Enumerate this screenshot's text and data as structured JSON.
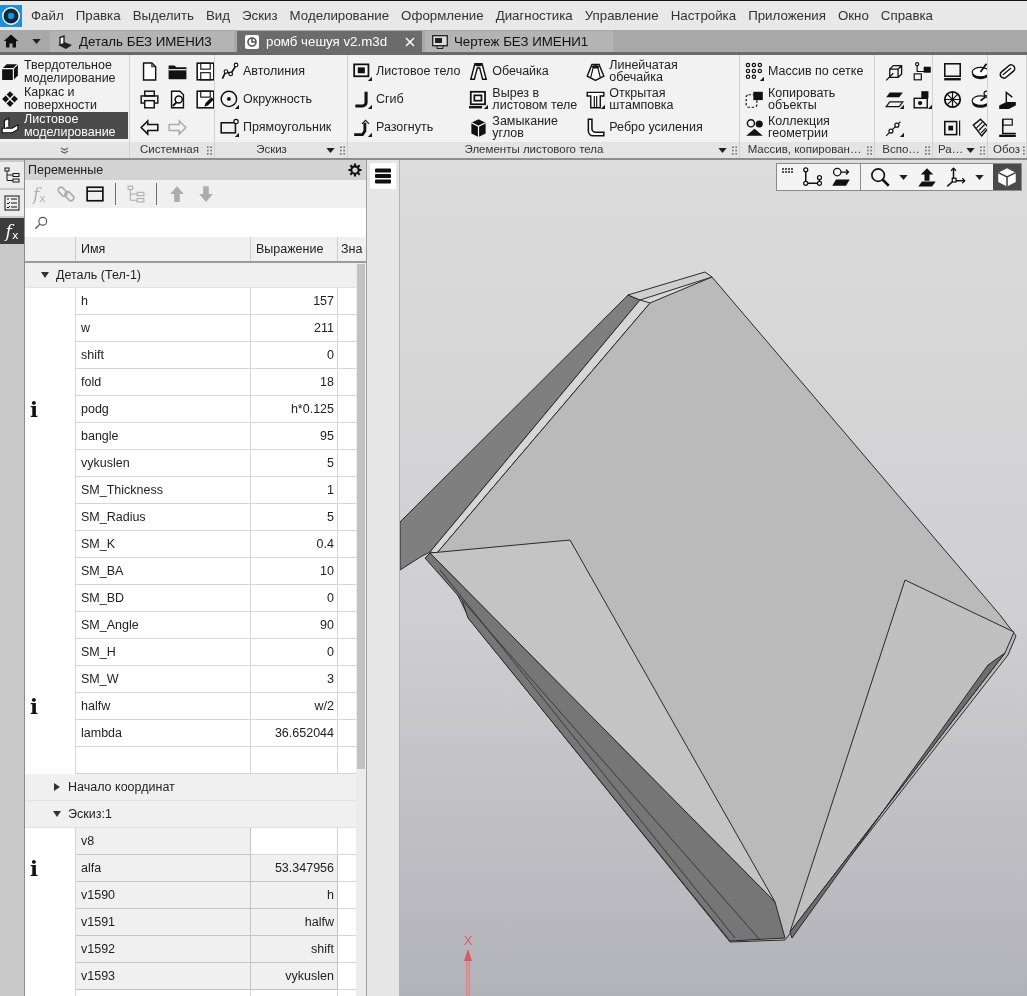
{
  "menu": [
    "Файл",
    "Правка",
    "Выделить",
    "Вид",
    "Эскиз",
    "Моделирование",
    "Оформление",
    "Диагностика",
    "Управление",
    "Настройка",
    "Приложения",
    "Окно",
    "Справка"
  ],
  "tabs": [
    {
      "label": "Деталь БЕЗ ИМЕНИ3",
      "selected": false
    },
    {
      "label": "ромб чешуя v2.m3d",
      "selected": true
    },
    {
      "label": "Чертеж БЕЗ ИМЕНИ1",
      "selected": false
    }
  ],
  "ribbon": {
    "modes": [
      {
        "label": "Твердотельное\nмоделирование",
        "selected": false
      },
      {
        "label": "Каркас и\nповерхности",
        "selected": false
      },
      {
        "label": "Листовое\nмоделирование",
        "selected": true
      }
    ],
    "groups": [
      {
        "kind": "icons",
        "title": "Системная",
        "dropdown": false,
        "buttons": [
          {
            "disabled": false
          },
          {
            "disabled": false
          },
          {
            "disabled": false
          },
          {
            "disabled": false
          },
          {
            "disabled": false
          },
          {
            "disabled": true
          },
          {
            "disabled": false
          },
          {
            "disabled": false
          }
        ]
      },
      {
        "kind": "commands",
        "title": "Эскиз",
        "dropdown": true,
        "columns": [
          [
            "Автолиния",
            "Окружность",
            "Прямоугольник"
          ]
        ]
      },
      {
        "kind": "commands",
        "title": "Элементы листового тела",
        "dropdown": true,
        "columns": [
          [
            "Листовое тело",
            "Сгиб",
            "Разогнуть"
          ],
          [
            "Обечайка",
            "Вырез в\nлистовом теле",
            "Замыкание\nуглов"
          ],
          [
            "Линейчатая\nобечайка",
            "Открытая\nштамповка",
            "Ребро усиления"
          ]
        ]
      },
      {
        "kind": "commands",
        "title": "Массив, копирован…",
        "dropdown": false,
        "columns": [
          [
            "Массив по сетке",
            "Копировать\nобъекты",
            "Коллекция\nгеометрии"
          ]
        ]
      },
      {
        "kind": "icons",
        "title": "Вспо…",
        "dropdown": false,
        "buttons": [
          {
            "disabled": false
          },
          {
            "disabled": false
          },
          {
            "disabled": false
          },
          {
            "disabled": false
          },
          {
            "disabled": false
          }
        ]
      },
      {
        "kind": "icons",
        "title": "Ра…",
        "dropdown": true,
        "buttons": [
          {
            "disabled": false
          },
          {
            "disabled": false
          },
          {
            "disabled": false
          },
          {
            "disabled": false
          },
          {
            "disabled": false
          },
          {
            "disabled": false
          }
        ]
      },
      {
        "kind": "icons",
        "title": "Обоз",
        "dropdown": false,
        "buttons": [
          {
            "disabled": false
          },
          {
            "disabled": false
          },
          {
            "disabled": false
          }
        ]
      }
    ]
  },
  "side_tabs": [
    {
      "selected": false
    },
    {
      "selected": false
    },
    {
      "label": "*f*$_{x}$",
      "selected": true
    }
  ],
  "variables": {
    "title": "Переменные",
    "tools": [
      {
        "label": "*f*$_{x}$",
        "disabled": true
      },
      {
        "disabled": true
      },
      {
        "disabled": false
      },
      {
        "disabled": true
      },
      {
        "disabled": true
      },
      {
        "disabled": true
      }
    ],
    "columns": [
      "Имя",
      "Выражение",
      "Зна"
    ],
    "groups": [
      {
        "kind": "group",
        "name": "Деталь (Тел-1)",
        "expanded": true,
        "children": [
          {
            "kind": "variable",
            "name": "h",
            "expression": "157",
            "readonly": false
          },
          {
            "kind": "variable",
            "name": "w",
            "expression": "211",
            "readonly": false
          },
          {
            "kind": "variable",
            "name": "shift",
            "expression": "0",
            "readonly": false
          },
          {
            "kind": "variable",
            "name": "fold",
            "expression": "18",
            "readonly": false
          },
          {
            "kind": "variable",
            "marker": "i",
            "name": "podg",
            "expression": "h*0.125",
            "readonly": false
          },
          {
            "kind": "variable",
            "name": "bangle",
            "expression": "95",
            "readonly": false
          },
          {
            "kind": "variable",
            "name": "vykuslen",
            "expression": "5",
            "readonly": false
          },
          {
            "kind": "variable",
            "name": "SM_Thickness",
            "expression": "1",
            "readonly": false
          },
          {
            "kind": "variable",
            "name": "SM_Radius",
            "expression": "5",
            "readonly": false
          },
          {
            "kind": "variable",
            "name": "SM_K",
            "expression": "0.4",
            "readonly": false
          },
          {
            "kind": "variable",
            "name": "SM_BA",
            "expression": "10",
            "readonly": false
          },
          {
            "kind": "variable",
            "name": "SM_BD",
            "expression": "0",
            "readonly": false
          },
          {
            "kind": "variable",
            "name": "SM_Angle",
            "expression": "90",
            "readonly": false
          },
          {
            "kind": "variable",
            "name": "SM_H",
            "expression": "0",
            "readonly": false
          },
          {
            "kind": "variable",
            "name": "SM_W",
            "expression": "3",
            "readonly": false
          },
          {
            "kind": "variable",
            "marker": "i",
            "name": "halfw",
            "expression": "w/2",
            "readonly": false
          },
          {
            "kind": "variable",
            "name": "lambda",
            "expression": "36.652044",
            "readonly": false
          },
          {
            "kind": "blank"
          },
          {
            "kind": "group",
            "name": "Начало координат",
            "expanded": false
          },
          {
            "kind": "group",
            "name": "Эскиз:1",
            "expanded": true,
            "children": [
              {
                "kind": "variable",
                "name": "v8",
                "readonly": true
              },
              {
                "kind": "variable",
                "marker": "i",
                "name": "alfa",
                "expression": "53.347956",
                "readonly": true
              },
              {
                "kind": "variable",
                "name": "v1590",
                "expression": "h",
                "readonly": true
              },
              {
                "kind": "variable",
                "name": "v1591",
                "expression": "halfw",
                "readonly": true
              },
              {
                "kind": "variable",
                "name": "v1592",
                "expression": "shift",
                "readonly": true
              },
              {
                "kind": "variable",
                "name": "v1593",
                "expression": "vykuslen",
                "readonly": true
              },
              {
                "kind": "blank"
              }
            ]
          }
        ]
      }
    ]
  },
  "viewport": {
    "toolbar": [
      {
        "selected": false,
        "dropdown": false
      },
      {
        "selected": false,
        "dropdown": false
      },
      {
        "selected": false,
        "dropdown": true
      },
      {
        "selected": false,
        "dropdown": false
      },
      {
        "selected": false,
        "dropdown": true
      },
      {
        "selected": true,
        "dropdown": false
      }
    ],
    "axis_label": "X"
  }
}
